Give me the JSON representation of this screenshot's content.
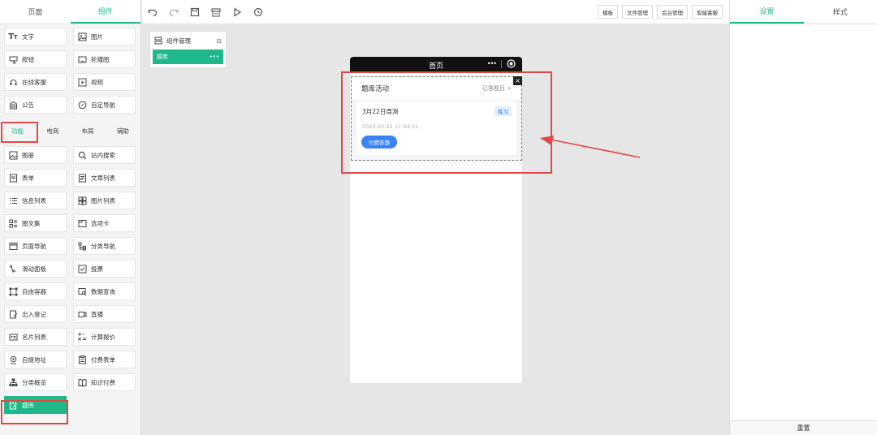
{
  "left": {
    "tabs": [
      "页面",
      "组件"
    ],
    "basic": [
      {
        "label": "文字",
        "icon": "text-icon"
      },
      {
        "label": "图片",
        "icon": "image-icon"
      },
      {
        "label": "按钮",
        "icon": "button-icon"
      },
      {
        "label": "轮播图",
        "icon": "carousel-icon"
      },
      {
        "label": "在线客服",
        "icon": "headset-icon"
      },
      {
        "label": "视频",
        "icon": "video-icon"
      },
      {
        "label": "公告",
        "icon": "notice-icon"
      },
      {
        "label": "自定导航",
        "icon": "compass-icon"
      }
    ],
    "categories": [
      "功能",
      "电商",
      "布局",
      "辅助"
    ],
    "func": [
      {
        "label": "图册",
        "icon": "album-icon"
      },
      {
        "label": "站内搜索",
        "icon": "search-icon"
      },
      {
        "label": "表单",
        "icon": "form-icon"
      },
      {
        "label": "文章列表",
        "icon": "article-list-icon"
      },
      {
        "label": "信息列表",
        "icon": "info-list-icon"
      },
      {
        "label": "图片列表",
        "icon": "image-grid-icon"
      },
      {
        "label": "图文集",
        "icon": "image-text-icon"
      },
      {
        "label": "选项卡",
        "icon": "tab-icon"
      },
      {
        "label": "页面导航",
        "icon": "page-nav-icon"
      },
      {
        "label": "分类导航",
        "icon": "category-nav-icon"
      },
      {
        "label": "滑动面板",
        "icon": "slide-panel-icon"
      },
      {
        "label": "投票",
        "icon": "vote-icon"
      },
      {
        "label": "自由容器",
        "icon": "container-icon"
      },
      {
        "label": "数据查询",
        "icon": "data-query-icon"
      },
      {
        "label": "出入登记",
        "icon": "register-icon"
      },
      {
        "label": "直播",
        "icon": "live-icon"
      },
      {
        "label": "名片列表",
        "icon": "card-list-icon"
      },
      {
        "label": "计算报价",
        "icon": "calculator-icon"
      },
      {
        "label": "自提地址",
        "icon": "location-icon"
      },
      {
        "label": "付费表单",
        "icon": "paid-form-icon"
      },
      {
        "label": "分类概览",
        "icon": "category-overview-icon"
      },
      {
        "label": "知识付费",
        "icon": "book-icon"
      },
      {
        "label": "题库",
        "icon": "quiz-icon"
      }
    ]
  },
  "toolbar": {
    "buttons": [
      "模板",
      "文件管理",
      "后台管理",
      "智能客服"
    ]
  },
  "manager": {
    "title": "组件管理",
    "item": "题库"
  },
  "phone": {
    "title": "首页",
    "section_title": "题库活动",
    "section_link": "已答题目",
    "card_title": "3月22日周测",
    "card_tag": "练习",
    "card_date": "2023-03-22 11:54:51",
    "card_button": "付费答题"
  },
  "right": {
    "tabs": [
      "设置",
      "样式"
    ],
    "reset": "重置"
  },
  "colors": {
    "accent": "#1fb88a",
    "annotation": "#e04848",
    "quiz_button": "#3b82f6"
  }
}
